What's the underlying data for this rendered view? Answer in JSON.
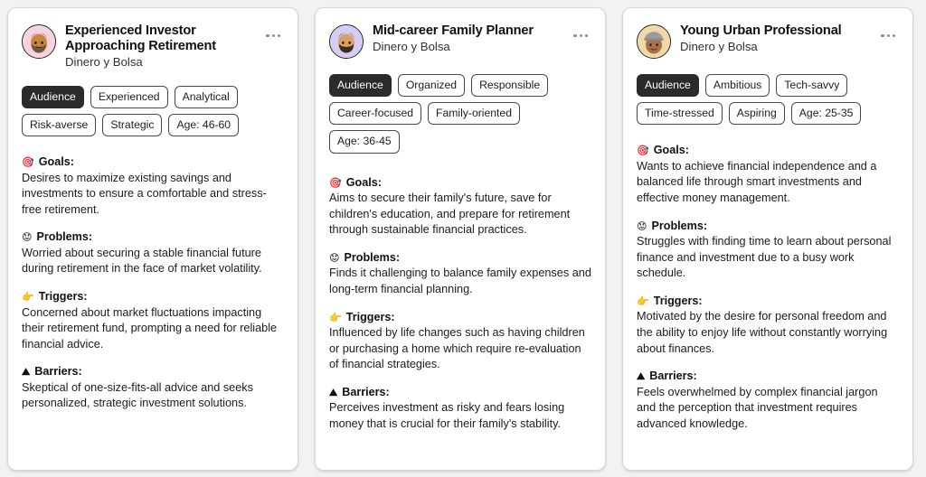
{
  "page": {
    "background_color": "#f2f2f2",
    "card_background": "#ffffff",
    "accent_dark": "#2b2b2b"
  },
  "cards": [
    {
      "title": "Experienced Investor Approaching Retirement",
      "subtitle": "Dinero y Bolsa",
      "avatar": {
        "name": "avatar-experienced-investor",
        "background_color": "#f7d3dd",
        "skin_color": "#c68642",
        "hair_color": "#6d5242",
        "description": "bearded older man on pink background"
      },
      "menu_icon": "more-options-icon",
      "tags": [
        {
          "label": "Audience",
          "primary": true
        },
        {
          "label": "Experienced",
          "primary": false
        },
        {
          "label": "Analytical",
          "primary": false
        },
        {
          "label": "Risk-averse",
          "primary": false
        },
        {
          "label": "Strategic",
          "primary": false
        },
        {
          "label": "Age: 46-60",
          "primary": false
        }
      ],
      "sections": [
        {
          "icon": "target-icon",
          "emoji": "🎯",
          "heading": "Goals:",
          "body": "Desires to maximize existing savings and investments to ensure a comfortable and stress-free retirement."
        },
        {
          "icon": "worried-face-icon",
          "emoji": "😟",
          "heading": "Problems:",
          "body": "Worried about securing a stable financial future during retirement in the face of market volatility."
        },
        {
          "icon": "pointing-finger-icon",
          "emoji": "👉",
          "heading": "Triggers:",
          "body": "Concerned about market fluctuations impacting their retirement fund, prompting a need for reliable financial advice."
        },
        {
          "icon": "mountain-icon",
          "emoji": "⛰",
          "heading": "Barriers:",
          "body": "Skeptical of one-size-fits-all advice and seeks personalized, strategic investment solutions."
        }
      ]
    },
    {
      "title": "Mid-career Family Planner",
      "subtitle": "Dinero y Bolsa",
      "avatar": {
        "name": "avatar-family-planner",
        "background_color": "#d6cdf2",
        "skin_color": "#d9a066",
        "hair_color": "#2f2620",
        "description": "dark-haired bearded man on lavender background"
      },
      "menu_icon": "more-options-icon",
      "tags": [
        {
          "label": "Audience",
          "primary": true
        },
        {
          "label": "Organized",
          "primary": false
        },
        {
          "label": "Responsible",
          "primary": false
        },
        {
          "label": "Career-focused",
          "primary": false
        },
        {
          "label": "Family-oriented",
          "primary": false
        },
        {
          "label": "Age: 36-45",
          "primary": false
        }
      ],
      "sections": [
        {
          "icon": "target-icon",
          "emoji": "🎯",
          "heading": "Goals:",
          "body": "Aims to secure their family's future, save for children's education, and prepare for retirement through sustainable financial practices."
        },
        {
          "icon": "worried-face-icon",
          "emoji": "😟",
          "heading": "Problems:",
          "body": "Finds it challenging to balance family expenses and long-term financial planning."
        },
        {
          "icon": "pointing-finger-icon",
          "emoji": "👉",
          "heading": "Triggers:",
          "body": "Influenced by life changes such as having children or purchasing a home which require re-evaluation of financial strategies."
        },
        {
          "icon": "mountain-icon",
          "emoji": "⛰",
          "heading": "Barriers:",
          "body": "Perceives investment as risky and fears losing money that is crucial for their family's stability."
        }
      ]
    },
    {
      "title": "Young Urban Professional",
      "subtitle": "Dinero y Bolsa",
      "avatar": {
        "name": "avatar-young-professional",
        "background_color": "#f0d9a8",
        "skin_color": "#a9714b",
        "hair_color": "#9b9b9b",
        "description": "young person wearing grey cap on tan background"
      },
      "menu_icon": "more-options-icon",
      "tags": [
        {
          "label": "Audience",
          "primary": true
        },
        {
          "label": "Ambitious",
          "primary": false
        },
        {
          "label": "Tech-savvy",
          "primary": false
        },
        {
          "label": "Time-stressed",
          "primary": false
        },
        {
          "label": "Aspiring",
          "primary": false
        },
        {
          "label": "Age: 25-35",
          "primary": false
        }
      ],
      "sections": [
        {
          "icon": "target-icon",
          "emoji": "🎯",
          "heading": "Goals:",
          "body": "Wants to achieve financial independence and a balanced life through smart investments and effective money management."
        },
        {
          "icon": "worried-face-icon",
          "emoji": "😟",
          "heading": "Problems:",
          "body": "Struggles with finding time to learn about personal finance and investment due to a busy work schedule."
        },
        {
          "icon": "pointing-finger-icon",
          "emoji": "👉",
          "heading": "Triggers:",
          "body": "Motivated by the desire for personal freedom and the ability to enjoy life without constantly worrying about finances."
        },
        {
          "icon": "mountain-icon",
          "emoji": "⛰",
          "heading": "Barriers:",
          "body": "Feels overwhelmed by complex financial jargon and the perception that investment requires advanced knowledge."
        }
      ]
    }
  ]
}
